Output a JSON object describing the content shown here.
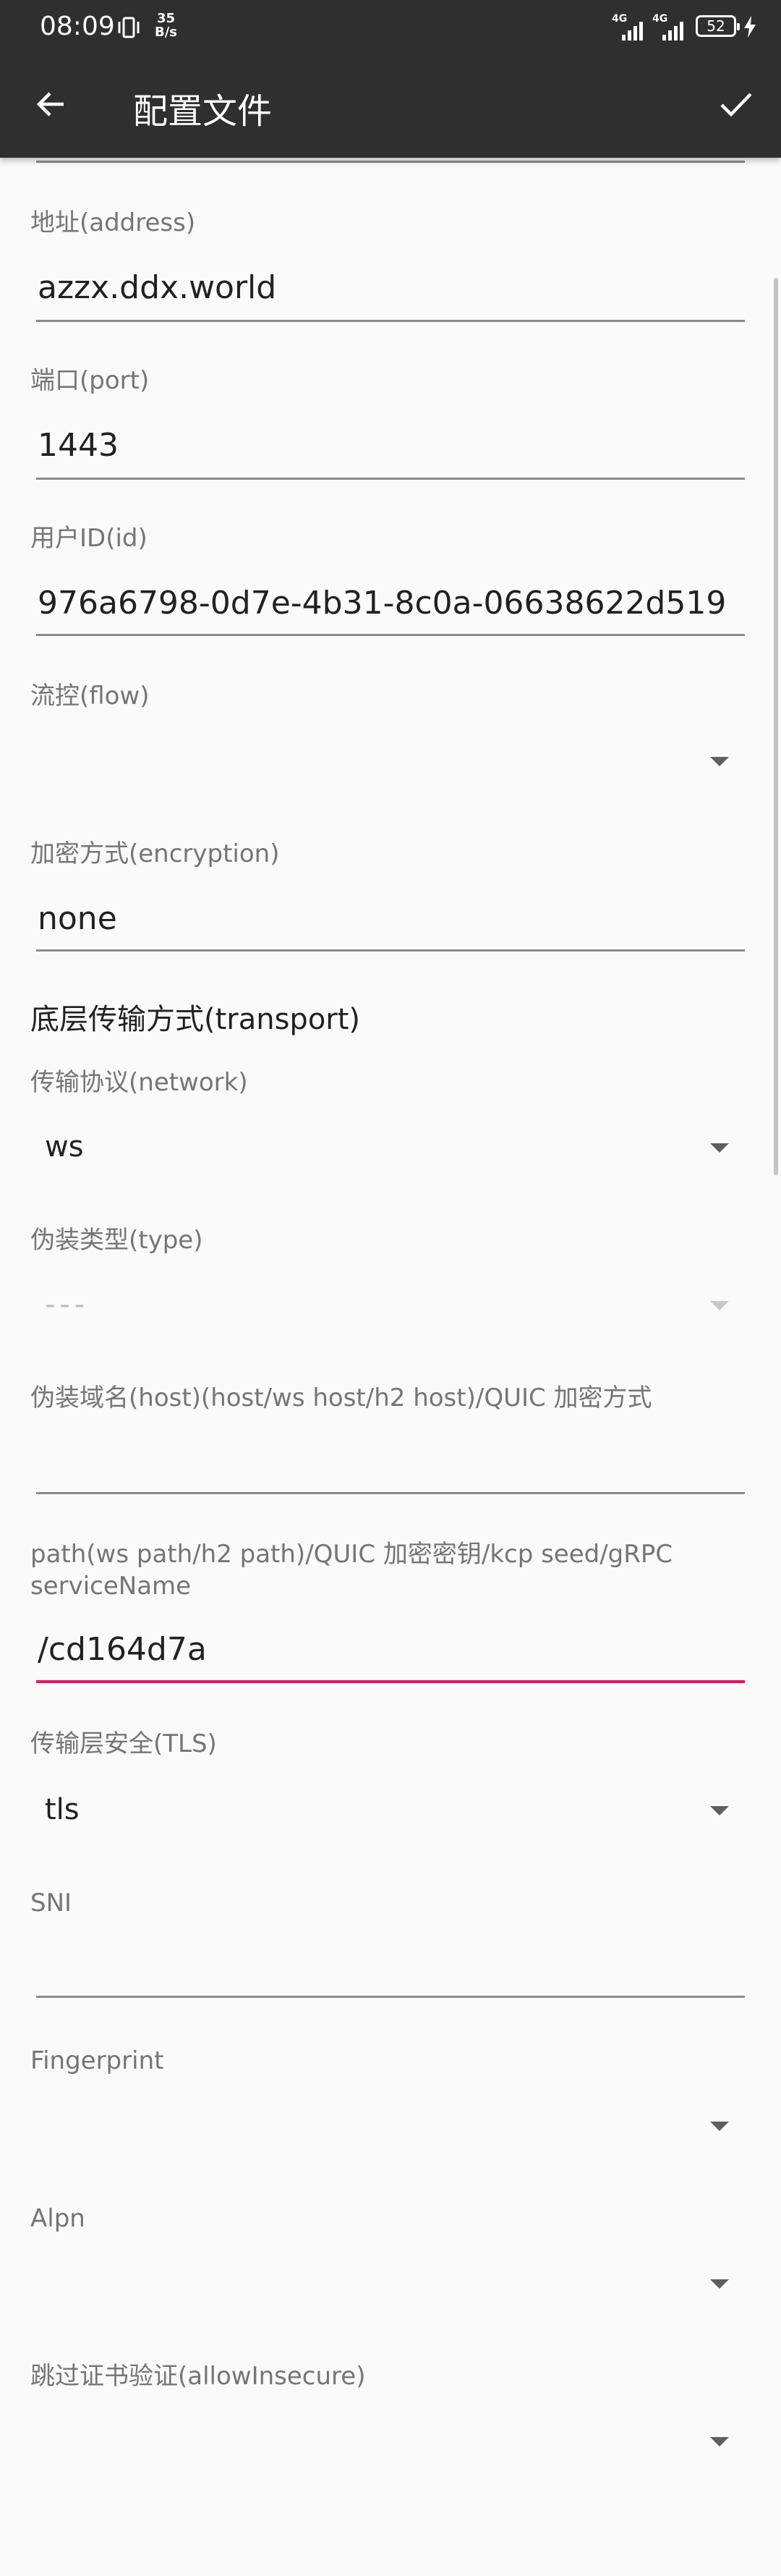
{
  "status_bar": {
    "time": "08:09",
    "speed_value": "35",
    "speed_unit": "B/s",
    "network_1": "4G",
    "network_2": "4G",
    "battery": "52"
  },
  "header": {
    "title": "配置文件",
    "back_icon": "arrow-left-icon",
    "confirm_icon": "check-icon"
  },
  "fields": {
    "address": {
      "label": "地址(address)",
      "value": "azzx.ddx.world"
    },
    "port": {
      "label": "端口(port)",
      "value": "1443"
    },
    "id": {
      "label": "用户ID(id)",
      "value": "976a6798-0d7e-4b31-8c0a-06638622d519"
    },
    "flow": {
      "label": "流控(flow)",
      "value": ""
    },
    "encryption": {
      "label": "加密方式(encryption)",
      "value": "none"
    }
  },
  "transport": {
    "section_title": "底层传输方式(transport)",
    "network": {
      "label": "传输协议(network)",
      "value": "ws"
    },
    "type": {
      "label": "伪装类型(type)",
      "value": "---"
    },
    "host": {
      "label": "伪装域名(host)(host/ws host/h2 host)/QUIC 加密方式",
      "value": ""
    },
    "path": {
      "label": "path(ws path/h2 path)/QUIC 加密密钥/kcp seed/gRPC serviceName",
      "value": "/cd164d7a"
    },
    "tls": {
      "label": "传输层安全(TLS)",
      "value": "tls"
    },
    "sni": {
      "label": "SNI",
      "value": ""
    },
    "fingerprint": {
      "label": "Fingerprint",
      "value": ""
    },
    "alpn": {
      "label": "Alpn",
      "value": ""
    },
    "allow_insecure": {
      "label": "跳过证书验证(allowInsecure)",
      "value": ""
    }
  },
  "colors": {
    "toolbar": "#2f2f2f",
    "background": "#fafafa",
    "accent": "#d81b60",
    "label": "#757575",
    "underline": "#8a8a8a"
  }
}
